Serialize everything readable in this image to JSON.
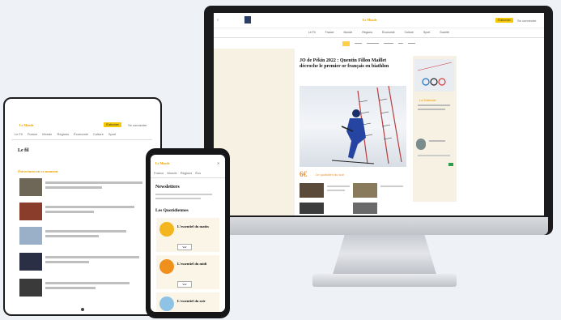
{
  "site": {
    "logo": "Le Monde",
    "subscribe": "S'abonner",
    "login": "Se connecter"
  },
  "desktop": {
    "nav": [
      "Le Fil",
      "France",
      "Monde",
      "Régions",
      "Économie",
      "Culture",
      "Sport",
      "Société"
    ],
    "lead_title": "JO de Pékin 2022 : Quentin Fillon Maillet décroche le premier or français en biathlon",
    "promo": "Le quotidien du soir",
    "side_caption": "La Matinale"
  },
  "tablet": {
    "nav": [
      "Le Fil",
      "France",
      "Monde",
      "Régions",
      "Économie",
      "Culture",
      "Sport"
    ],
    "page_title": "Le fil",
    "section": "Ouvertures en ce moment"
  },
  "phone": {
    "nav": [
      "France",
      "Monde",
      "Régions",
      "Éco"
    ],
    "title1": "Newsletters",
    "title2": "Les Quotidiennes",
    "cards": [
      {
        "label": "L'essentiel du matin",
        "color": "#f3b61f",
        "btn": "Voir"
      },
      {
        "label": "L'essentiel du midi",
        "color": "#ef8f1c",
        "btn": "Voir"
      },
      {
        "label": "L'essentiel du soir",
        "color": "#8fc3e6",
        "btn": "Voir"
      }
    ]
  }
}
